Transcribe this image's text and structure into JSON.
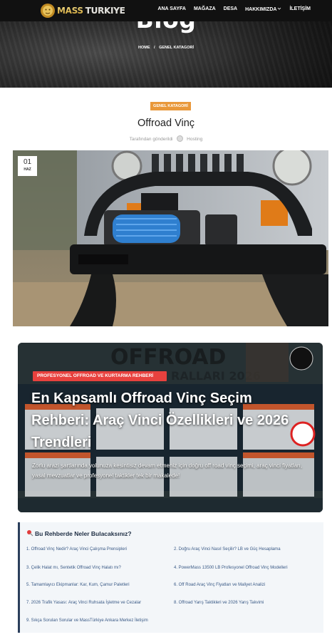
{
  "header": {
    "logo_text_1": "MASS",
    "logo_text_2": "TURKIYE",
    "nav": [
      "ANA SAYFA",
      "MAĞAZA",
      "DESA",
      "HAKKIMIZDA",
      "İLETİŞİM"
    ],
    "hero_title": "Blog",
    "breadcrumb": [
      "HOME",
      "/",
      "GENEL KATAGORİ"
    ]
  },
  "post": {
    "category": "GENEL KATAGORİ",
    "title": "Offroad Vinç",
    "byline_prefix": "Tarafından gönderildi",
    "author": "Hosting",
    "date_day": "01",
    "date_month": "HAZ"
  },
  "infographic": {
    "tag": "PROFESYONEL OFFROAD VE KURTARMA REHBERİ",
    "headline": "En Kapsamlı Offroad Vinç Seçim Rehberi: Araç Vinci Özellikleri ve 2026 Trendleri",
    "description": "Zorlu arazi şartlarında yolunuza kesintisiz devam etmeniz için doğru off road vinç seçimi, araç vinci fiyatları, yasal mevzuatlar ve profesyonel taktikler tek bir makalede!",
    "bg_word": "OFFROAD",
    "bg_sub": "RALLARI 2026"
  },
  "toc": {
    "title": "Bu Rehberde Neler Bulacaksınız?",
    "items": [
      "1. Offroad Vinç Nedir? Araç Vinci Çalışma Prensipleri",
      "2. Doğru Araç Vinci Nasıl Seçilir? LB ve Güç Hesaplama",
      "3. Çelik Halat mı, Sentetik Offroad Vinç Halatı mı?",
      "4. PowerMass 13500 LB Profesyonel Offroad Vinç Modelleri",
      "5. Tamamlayıcı Ekipmanlar: Kar, Kum, Çamur Paletleri",
      "6. Off Road Araç Vinç Fiyatları ve Maliyet Analizi",
      "7. 2026 Trafik Yasası: Araç Vinci Ruhsata İşletme ve Cezalar",
      "8. Offroad Yarış Taktikleri ve 2026 Yarış Takvimi",
      "9. Sıkça Sorulan Sorular ve MassTürkiye Ankara Merkez İletişim"
    ]
  },
  "colors": {
    "accent_orange": "#e9983a",
    "tag_red": "#e8413e",
    "toc_bar": "#2b3f5c",
    "toc_link": "#3a5a86"
  },
  "icons": [
    "lion-logo-icon",
    "pin-icon",
    "avatar-icon"
  ]
}
